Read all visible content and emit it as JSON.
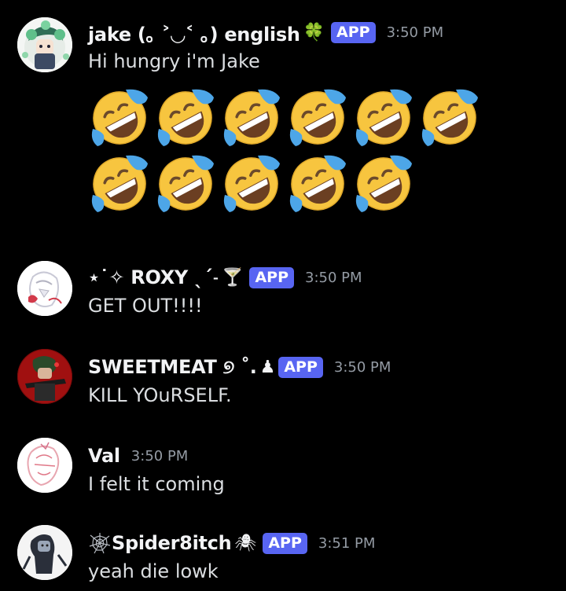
{
  "messages": [
    {
      "username": "jake (｡ ˃◡˂ ｡) english",
      "decoration": "🍀",
      "badge": "APP",
      "time": "3:50 PM",
      "text": "Hi hungry i'm Jake",
      "emoji_name": "rolling-on-the-floor-laughing",
      "emoji_count": 11
    },
    {
      "username": "⋆˙✧ ROXY ˎˊ˗",
      "decoration": "🍸",
      "badge": "APP",
      "time": "3:50 PM",
      "text": "GET OUT!!!!"
    },
    {
      "username": "SWEETMEAT ୭ ˚.",
      "decoration": "♟",
      "badge": "APP",
      "time": "3:50 PM",
      "text": "KILL YOuRSELF."
    },
    {
      "username": "Val",
      "time": "3:50 PM",
      "text": "I felt it coming"
    },
    {
      "username": "Spider8itch",
      "prefix_icon": "spider-web-icon",
      "decoration": "🕷",
      "badge": "APP",
      "time": "3:51 PM",
      "text": "yeah die lowk"
    }
  ],
  "colors": {
    "background": "#000000",
    "username": "#f2f3f5",
    "message_text": "#dbdee1",
    "timestamp": "#949ba4",
    "app_badge": "#5865f2"
  }
}
